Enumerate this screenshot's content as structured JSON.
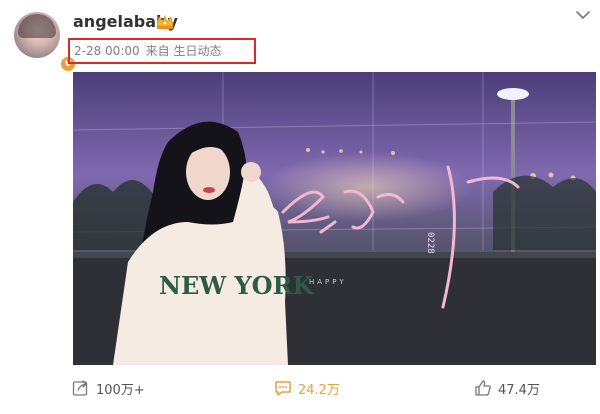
{
  "post": {
    "username": "angelababy",
    "timestamp": "2-28 00:00",
    "source_prefix": "来自",
    "source": "生日动态"
  },
  "image": {
    "vertical_text": "0228",
    "small_text": "HAPPY",
    "jersey_text": "NEW YORK"
  },
  "actions": {
    "forward_count": "100万+",
    "comment_count": "24.2万",
    "like_count": "47.4万"
  },
  "colors": {
    "highlight_border": "#d8292b",
    "comment_accent": "#e9a13b",
    "verified_badge": "#e9a13b"
  }
}
